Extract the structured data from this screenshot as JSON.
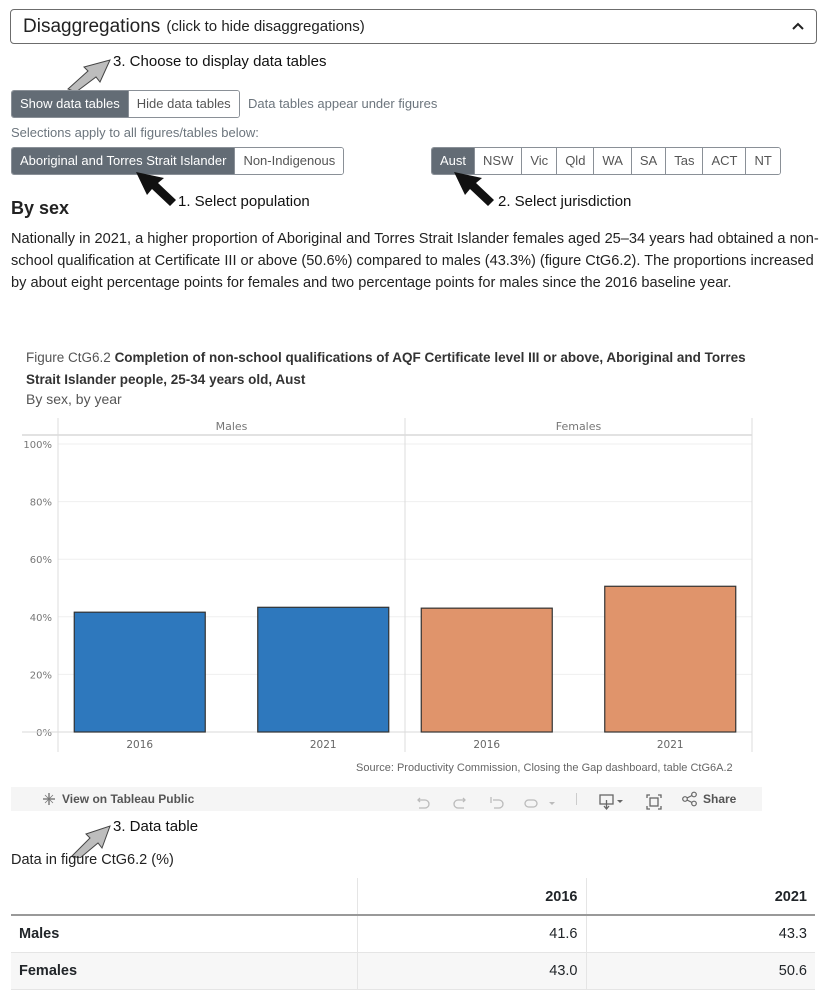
{
  "disaggregations": {
    "title": "Disaggregations",
    "hint": "(click to hide disaggregations)",
    "toggle_icon": "chevron-up-icon"
  },
  "annotations": {
    "step3_choose": "3. Choose to display data tables",
    "step1": "1. Select population",
    "step2": "2. Select jurisdiction",
    "step3_table": "3. Data table"
  },
  "data_tables_toggle": {
    "options": [
      "Show data tables",
      "Hide data tables"
    ],
    "selected": "Show data tables",
    "note": "Data tables appear under figures"
  },
  "selections_note": "Selections apply to all figures/tables below:",
  "population": {
    "options": [
      "Aboriginal and Torres Strait Islander",
      "Non-Indigenous"
    ],
    "selected": "Aboriginal and Torres Strait Islander"
  },
  "jurisdiction": {
    "options": [
      "Aust",
      "NSW",
      "Vic",
      "Qld",
      "WA",
      "SA",
      "Tas",
      "ACT",
      "NT"
    ],
    "selected": "Aust"
  },
  "section": {
    "heading": "By sex",
    "paragraph": "Nationally in 2021, a higher proportion of Aboriginal and Torres Strait Islander females aged 25–34 years had obtained a non-school qualification at Certificate III or above (50.6%) compared to males (43.3%) (figure CtG6.2). The proportions increased by about eight percentage points for females and two percentage points for males since the 2016 baseline year."
  },
  "figure": {
    "label": "Figure CtG6.2",
    "title": "Completion of non-school qualifications of AQF Certificate level III or above, Aboriginal and Torres Strait Islander people, 25-34 years old, Aust",
    "subtitle": "By sex, by year",
    "source": "Source: Productivity Commission, Closing the Gap dashboard, table CtG6A.2"
  },
  "chart_data": {
    "type": "bar",
    "title": "Completion of non-school qualifications of AQF Certificate level III or above, Aboriginal and Torres Strait Islander people, 25-34 years old, Aust",
    "subtitle": "By sex, by year",
    "panels": [
      "Males",
      "Females"
    ],
    "categories": [
      "2016",
      "2021"
    ],
    "series": [
      {
        "name": "Males",
        "values": [
          41.6,
          43.3
        ],
        "color": "#2e78bd"
      },
      {
        "name": "Females",
        "values": [
          43.0,
          50.6
        ],
        "color": "#e0946b"
      }
    ],
    "xlabel": "",
    "ylabel": "",
    "ylim": [
      0,
      100
    ],
    "yticks": [
      0,
      20,
      40,
      60,
      80,
      100
    ],
    "ytick_labels": [
      "0%",
      "20%",
      "40%",
      "60%",
      "80%",
      "100%"
    ],
    "grid": true,
    "legend": "none"
  },
  "tableau_toolbar": {
    "view_label": "View on Tableau Public",
    "share_label": "Share",
    "icons": [
      "tableau-logo-icon",
      "undo-icon",
      "redo-icon",
      "revert-icon",
      "refresh-icon",
      "pause-dropdown-icon",
      "download-icon",
      "fullscreen-icon",
      "share-icon"
    ]
  },
  "data_table": {
    "title": "Data in figure CtG6.2 (%)",
    "columns": [
      "",
      "2016",
      "2021"
    ],
    "rows": [
      {
        "label": "Males",
        "values": [
          "41.6",
          "43.3"
        ]
      },
      {
        "label": "Females",
        "values": [
          "43.0",
          "50.6"
        ]
      }
    ]
  }
}
